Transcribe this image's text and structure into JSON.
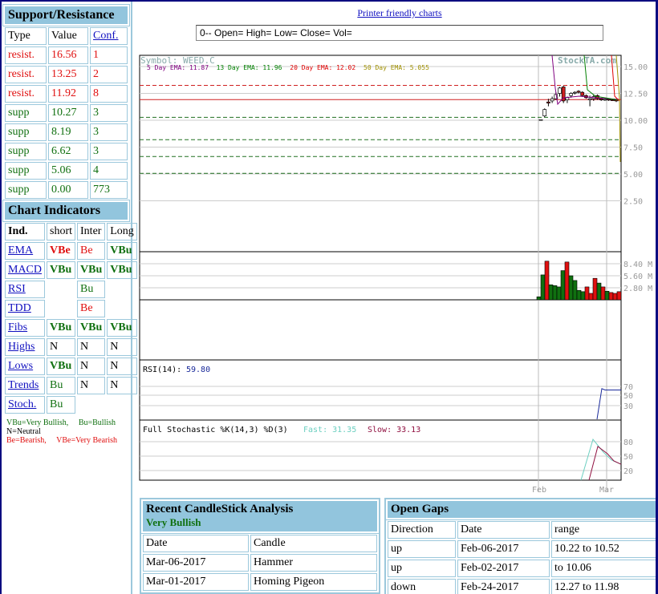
{
  "support_resistance": {
    "title": "Support/Resistance",
    "headers": [
      "Type",
      "Value",
      "Conf."
    ],
    "rows": [
      [
        "resist.",
        "16.56",
        "1"
      ],
      [
        "resist.",
        "13.25",
        "2"
      ],
      [
        "resist.",
        "11.92",
        "8"
      ],
      [
        "supp",
        "10.27",
        "3"
      ],
      [
        "supp",
        "8.19",
        "3"
      ],
      [
        "supp",
        "6.62",
        "3"
      ],
      [
        "supp",
        "5.06",
        "4"
      ],
      [
        "supp",
        "0.00",
        "773"
      ]
    ]
  },
  "indicators": {
    "title": "Chart Indicators",
    "headers": [
      "Ind.",
      "short",
      "Inter",
      "Long"
    ],
    "rows": [
      [
        "EMA",
        "VBe",
        "Be",
        "VBu"
      ],
      [
        "MACD",
        "VBu",
        "VBu",
        "VBu"
      ],
      [
        "RSI",
        "",
        "Bu",
        ""
      ],
      [
        "TDD",
        "",
        "Be",
        ""
      ],
      [
        "Fibs",
        "VBu",
        "VBu",
        "VBu"
      ],
      [
        "Highs",
        "N",
        "N",
        "N"
      ],
      [
        "Lows",
        "VBu",
        "N",
        "N"
      ],
      [
        "Trends",
        "Bu",
        "N",
        "N"
      ],
      [
        "Stoch.",
        "Bu",
        "",
        ""
      ]
    ]
  },
  "legend": {
    "vbu": "VBu=Very Bullish,",
    "bu": "Bu=Bullish",
    "n": "N=Neutral",
    "be": "Be=Bearish,",
    "vbe": "VBe=Very Bearish"
  },
  "printer_link": "Printer friendly charts",
  "ohlc_readout": "0-- Open= High= Low= Close= Vol=",
  "chart": {
    "symbol": "Symbol: WEED.C",
    "watermark": "StockTA.com",
    "ema": [
      {
        "label": "5 Day EMA: 11.87",
        "color": "#800080"
      },
      {
        "label": "13 Day EMA: 11.96",
        "color": "#008000"
      },
      {
        "label": "20 Day EMA: 12.02",
        "color": "#e00000"
      },
      {
        "label": "50 Day EMA: 5.055",
        "color": "#a09000"
      }
    ],
    "price_ticks": [
      "15.00",
      "12.50",
      "10.00",
      "7.50",
      "5.00",
      "2.50"
    ],
    "volume_ticks": [
      "8.40 M",
      "5.60 M",
      "2.80 M"
    ],
    "rsi_label": "RSI(14):",
    "rsi_value": "59.80",
    "rsi_ticks": [
      "70",
      "50",
      "30"
    ],
    "stoch_label": "Full Stochastic %K(14,3) %D(3)",
    "fast_label": "Fast: 31.35",
    "slow_label": "Slow: 33.13",
    "stoch_ticks": [
      "80",
      "50",
      "20"
    ],
    "x_labels": [
      "Feb",
      "Mar"
    ],
    "colors": {
      "up": "#107010",
      "down": "#e01010",
      "fast": "#6ccfc0",
      "slow": "#901040",
      "rsi": "#1a2a9a"
    }
  },
  "chart_data": {
    "type": "candlestick",
    "ohlc": [
      [
        10.06,
        10.06,
        10.0,
        10.06
      ],
      [
        10.4,
        11.1,
        10.3,
        11.0
      ],
      [
        11.7,
        12.0,
        11.3,
        11.6
      ],
      [
        11.8,
        12.2,
        11.6,
        12.0
      ],
      [
        12.0,
        12.6,
        11.9,
        12.4
      ],
      [
        12.5,
        13.1,
        12.2,
        13.0
      ],
      [
        13.1,
        13.2,
        11.6,
        11.8
      ],
      [
        11.9,
        12.2,
        11.6,
        12.1
      ],
      [
        12.3,
        12.6,
        12.1,
        12.5
      ],
      [
        12.6,
        12.7,
        12.4,
        12.6
      ],
      [
        12.7,
        12.8,
        12.5,
        12.6
      ],
      [
        12.6,
        12.7,
        12.2,
        12.3
      ],
      [
        12.3,
        12.4,
        12.0,
        12.1
      ],
      [
        11.9,
        12.3,
        11.3,
        12.0
      ],
      [
        12.0,
        12.4,
        11.8,
        12.2
      ],
      [
        12.3,
        12.4,
        11.9,
        12.0
      ],
      [
        12.0,
        12.1,
        11.8,
        11.9
      ],
      [
        11.9,
        12.0,
        11.8,
        11.95
      ],
      [
        11.95,
        12.0,
        11.8,
        11.9
      ],
      [
        11.9,
        11.95,
        11.8,
        11.85
      ],
      [
        11.9,
        11.95,
        11.7,
        11.8
      ]
    ],
    "volume_m": [
      0.7,
      5.8,
      9.0,
      3.5,
      3.3,
      3.0,
      6.8,
      8.8,
      5.6,
      4.5,
      2.2,
      1.9,
      3.0,
      1.5,
      5.0,
      3.9,
      3.0,
      2.0,
      1.7,
      1.5,
      1.9
    ],
    "volume_up": [
      1,
      1,
      0,
      1,
      1,
      1,
      1,
      0,
      1,
      1,
      1,
      1,
      0,
      0,
      0,
      1,
      0,
      1,
      0,
      0,
      0
    ],
    "rsi": [
      67,
      64,
      64,
      64
    ],
    "stoch_fast": [
      0,
      85,
      58,
      42,
      33
    ],
    "stoch_slow": [
      0,
      70,
      55,
      40,
      33
    ]
  },
  "candlestick": {
    "title": "Recent CandleStick Analysis",
    "signal": "Very Bullish",
    "headers": [
      "Date",
      "Candle"
    ],
    "rows": [
      [
        "Mar-06-2017",
        "Hammer"
      ],
      [
        "Mar-01-2017",
        "Homing Pigeon"
      ]
    ]
  },
  "gaps": {
    "title": "Open Gaps",
    "headers": [
      "Direction",
      "Date",
      "range"
    ],
    "rows": [
      [
        "up",
        "Feb-06-2017",
        "10.22 to 10.52"
      ],
      [
        "up",
        "Feb-02-2017",
        "to 10.06"
      ],
      [
        "down",
        "Feb-24-2017",
        "12.27 to 11.98"
      ]
    ]
  }
}
